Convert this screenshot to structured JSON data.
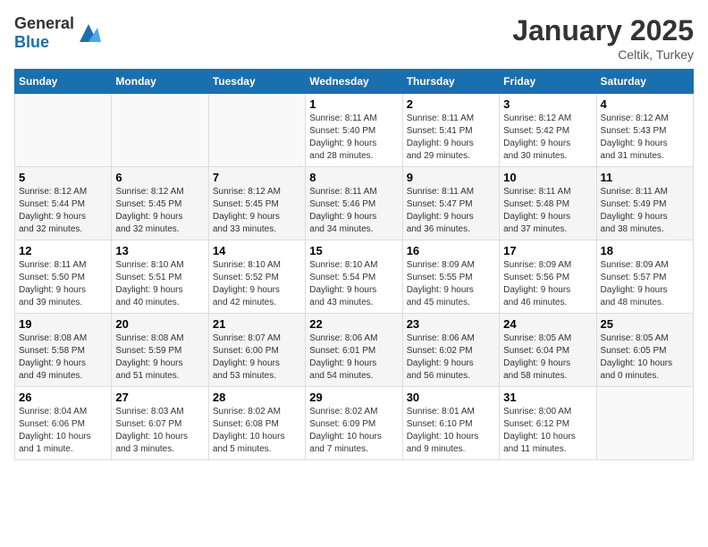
{
  "header": {
    "logo_general": "General",
    "logo_blue": "Blue",
    "title": "January 2025",
    "subtitle": "Celtik, Turkey"
  },
  "days_of_week": [
    "Sunday",
    "Monday",
    "Tuesday",
    "Wednesday",
    "Thursday",
    "Friday",
    "Saturday"
  ],
  "weeks": [
    [
      {
        "day": "",
        "info": ""
      },
      {
        "day": "",
        "info": ""
      },
      {
        "day": "",
        "info": ""
      },
      {
        "day": "1",
        "info": "Sunrise: 8:11 AM\nSunset: 5:40 PM\nDaylight: 9 hours\nand 28 minutes."
      },
      {
        "day": "2",
        "info": "Sunrise: 8:11 AM\nSunset: 5:41 PM\nDaylight: 9 hours\nand 29 minutes."
      },
      {
        "day": "3",
        "info": "Sunrise: 8:12 AM\nSunset: 5:42 PM\nDaylight: 9 hours\nand 30 minutes."
      },
      {
        "day": "4",
        "info": "Sunrise: 8:12 AM\nSunset: 5:43 PM\nDaylight: 9 hours\nand 31 minutes."
      }
    ],
    [
      {
        "day": "5",
        "info": "Sunrise: 8:12 AM\nSunset: 5:44 PM\nDaylight: 9 hours\nand 32 minutes."
      },
      {
        "day": "6",
        "info": "Sunrise: 8:12 AM\nSunset: 5:45 PM\nDaylight: 9 hours\nand 32 minutes."
      },
      {
        "day": "7",
        "info": "Sunrise: 8:12 AM\nSunset: 5:45 PM\nDaylight: 9 hours\nand 33 minutes."
      },
      {
        "day": "8",
        "info": "Sunrise: 8:11 AM\nSunset: 5:46 PM\nDaylight: 9 hours\nand 34 minutes."
      },
      {
        "day": "9",
        "info": "Sunrise: 8:11 AM\nSunset: 5:47 PM\nDaylight: 9 hours\nand 36 minutes."
      },
      {
        "day": "10",
        "info": "Sunrise: 8:11 AM\nSunset: 5:48 PM\nDaylight: 9 hours\nand 37 minutes."
      },
      {
        "day": "11",
        "info": "Sunrise: 8:11 AM\nSunset: 5:49 PM\nDaylight: 9 hours\nand 38 minutes."
      }
    ],
    [
      {
        "day": "12",
        "info": "Sunrise: 8:11 AM\nSunset: 5:50 PM\nDaylight: 9 hours\nand 39 minutes."
      },
      {
        "day": "13",
        "info": "Sunrise: 8:10 AM\nSunset: 5:51 PM\nDaylight: 9 hours\nand 40 minutes."
      },
      {
        "day": "14",
        "info": "Sunrise: 8:10 AM\nSunset: 5:52 PM\nDaylight: 9 hours\nand 42 minutes."
      },
      {
        "day": "15",
        "info": "Sunrise: 8:10 AM\nSunset: 5:54 PM\nDaylight: 9 hours\nand 43 minutes."
      },
      {
        "day": "16",
        "info": "Sunrise: 8:09 AM\nSunset: 5:55 PM\nDaylight: 9 hours\nand 45 minutes."
      },
      {
        "day": "17",
        "info": "Sunrise: 8:09 AM\nSunset: 5:56 PM\nDaylight: 9 hours\nand 46 minutes."
      },
      {
        "day": "18",
        "info": "Sunrise: 8:09 AM\nSunset: 5:57 PM\nDaylight: 9 hours\nand 48 minutes."
      }
    ],
    [
      {
        "day": "19",
        "info": "Sunrise: 8:08 AM\nSunset: 5:58 PM\nDaylight: 9 hours\nand 49 minutes."
      },
      {
        "day": "20",
        "info": "Sunrise: 8:08 AM\nSunset: 5:59 PM\nDaylight: 9 hours\nand 51 minutes."
      },
      {
        "day": "21",
        "info": "Sunrise: 8:07 AM\nSunset: 6:00 PM\nDaylight: 9 hours\nand 53 minutes."
      },
      {
        "day": "22",
        "info": "Sunrise: 8:06 AM\nSunset: 6:01 PM\nDaylight: 9 hours\nand 54 minutes."
      },
      {
        "day": "23",
        "info": "Sunrise: 8:06 AM\nSunset: 6:02 PM\nDaylight: 9 hours\nand 56 minutes."
      },
      {
        "day": "24",
        "info": "Sunrise: 8:05 AM\nSunset: 6:04 PM\nDaylight: 9 hours\nand 58 minutes."
      },
      {
        "day": "25",
        "info": "Sunrise: 8:05 AM\nSunset: 6:05 PM\nDaylight: 10 hours\nand 0 minutes."
      }
    ],
    [
      {
        "day": "26",
        "info": "Sunrise: 8:04 AM\nSunset: 6:06 PM\nDaylight: 10 hours\nand 1 minute."
      },
      {
        "day": "27",
        "info": "Sunrise: 8:03 AM\nSunset: 6:07 PM\nDaylight: 10 hours\nand 3 minutes."
      },
      {
        "day": "28",
        "info": "Sunrise: 8:02 AM\nSunset: 6:08 PM\nDaylight: 10 hours\nand 5 minutes."
      },
      {
        "day": "29",
        "info": "Sunrise: 8:02 AM\nSunset: 6:09 PM\nDaylight: 10 hours\nand 7 minutes."
      },
      {
        "day": "30",
        "info": "Sunrise: 8:01 AM\nSunset: 6:10 PM\nDaylight: 10 hours\nand 9 minutes."
      },
      {
        "day": "31",
        "info": "Sunrise: 8:00 AM\nSunset: 6:12 PM\nDaylight: 10 hours\nand 11 minutes."
      },
      {
        "day": "",
        "info": ""
      }
    ]
  ]
}
